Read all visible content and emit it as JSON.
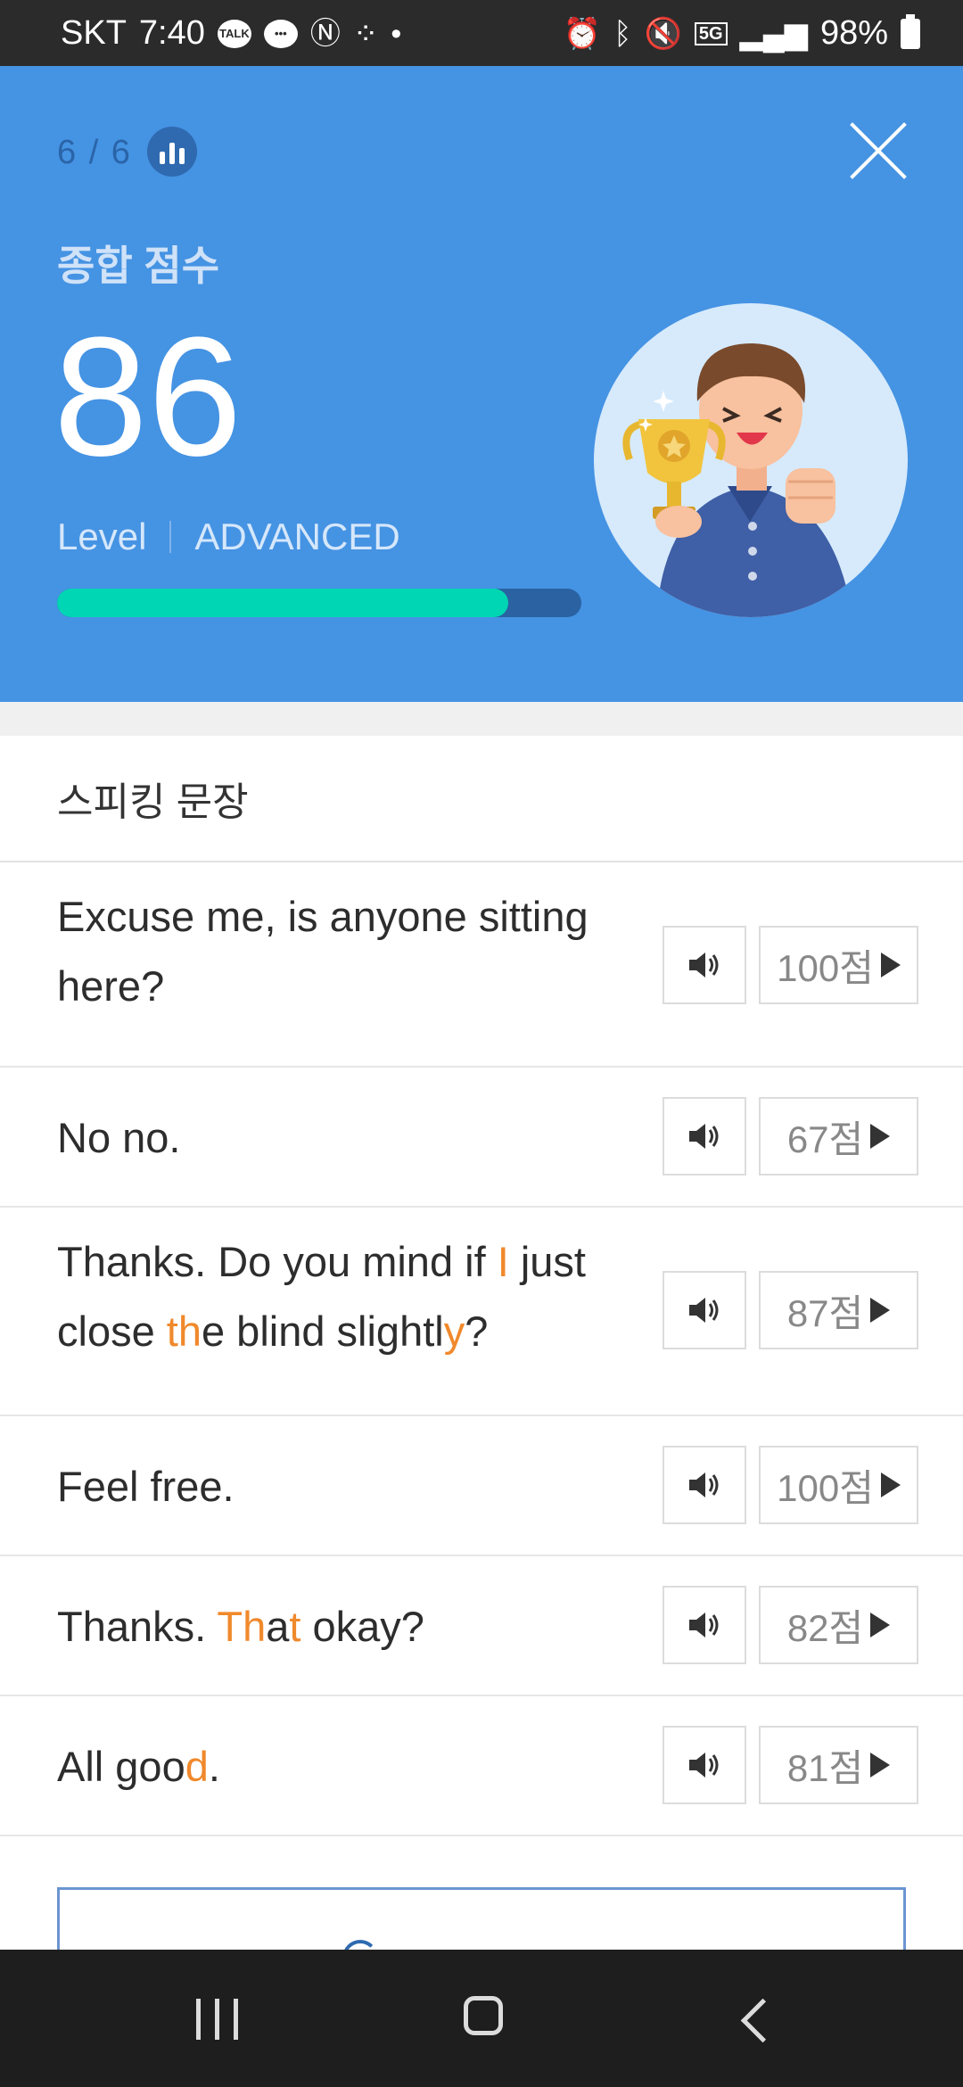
{
  "status_bar": {
    "carrier": "SKT",
    "time": "7:40",
    "talk_label": "TALK",
    "battery": "98%",
    "network": "5G"
  },
  "header": {
    "progress": "6 / 6",
    "score_label": "종합 점수",
    "score": "86",
    "level_label": "Level",
    "level_value": "ADVANCED",
    "score_fraction": 0.86
  },
  "section": {
    "title": "스피킹 문장"
  },
  "sentences": [
    {
      "parts": [
        {
          "t": "Excuse me, is anyone sitting here?",
          "h": false
        }
      ],
      "score": "100점"
    },
    {
      "parts": [
        {
          "t": "No no.",
          "h": false
        }
      ],
      "score": "67점"
    },
    {
      "parts": [
        {
          "t": "Thanks. Do you mind if ",
          "h": false
        },
        {
          "t": "I",
          "h": true
        },
        {
          "t": " just close ",
          "h": false
        },
        {
          "t": "th",
          "h": true
        },
        {
          "t": "e blind slightl",
          "h": false
        },
        {
          "t": "y",
          "h": true
        },
        {
          "t": "?",
          "h": false
        }
      ],
      "score": "87점"
    },
    {
      "parts": [
        {
          "t": "Feel free.",
          "h": false
        }
      ],
      "score": "100점"
    },
    {
      "parts": [
        {
          "t": "Thanks. ",
          "h": false
        },
        {
          "t": "Th",
          "h": true
        },
        {
          "t": "a",
          "h": false
        },
        {
          "t": "t",
          "h": true
        },
        {
          "t": " okay?",
          "h": false
        }
      ],
      "score": "82점"
    },
    {
      "parts": [
        {
          "t": "All goo",
          "h": false
        },
        {
          "t": "d",
          "h": true
        },
        {
          "t": ".",
          "h": false
        }
      ],
      "score": "81점"
    }
  ],
  "retry": {
    "label": "전체 다시하기"
  },
  "colors": {
    "header_bg": "#4593e3",
    "progress_fill": "#00d6b4",
    "highlight": "#f0892c"
  }
}
